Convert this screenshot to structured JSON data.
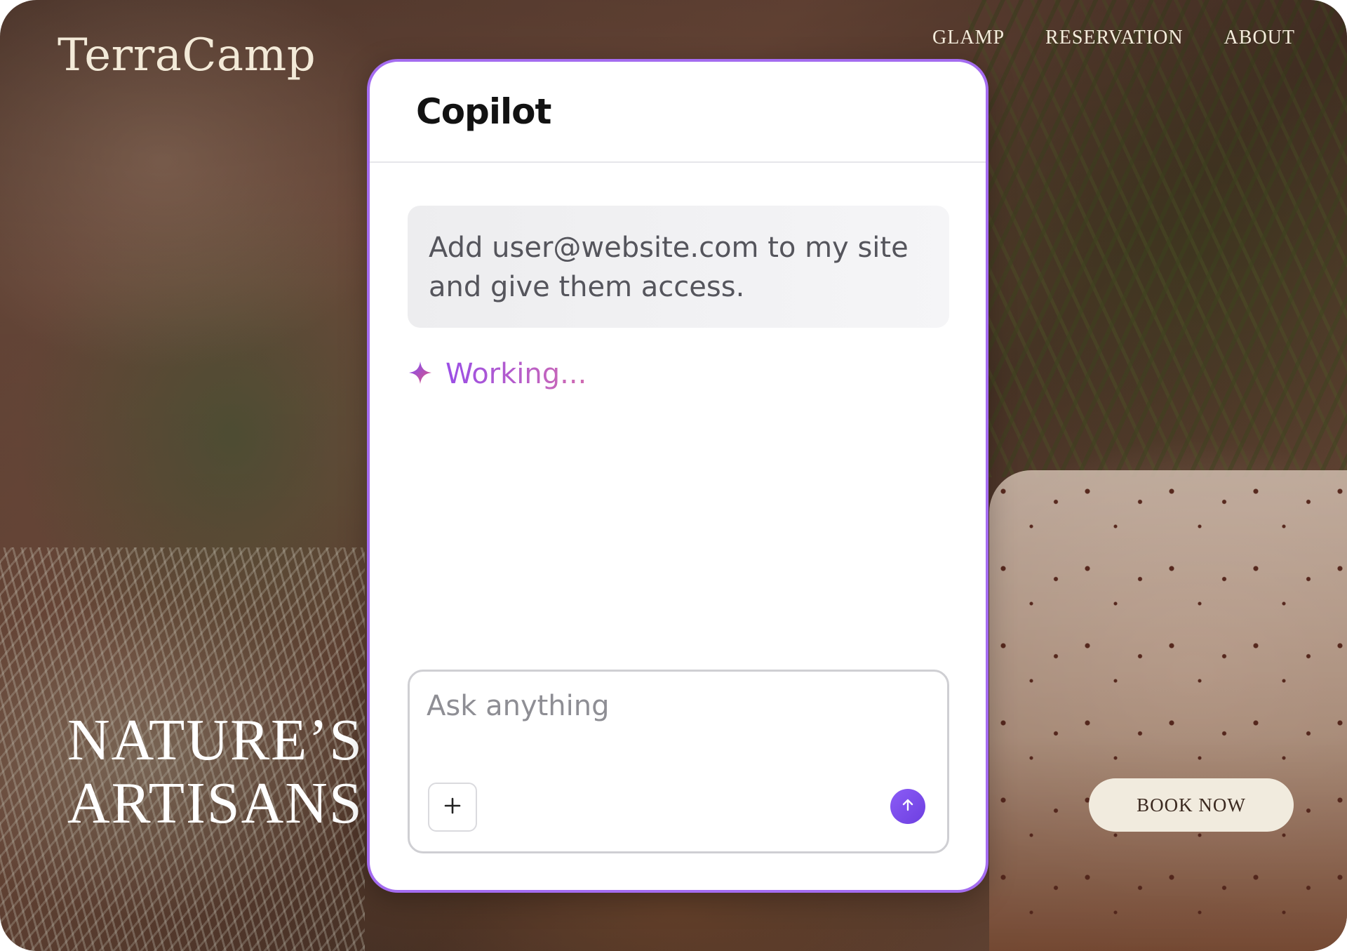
{
  "site": {
    "logo": "TerraCamp",
    "nav": [
      {
        "label": "GLAMP"
      },
      {
        "label": "RESERVATION"
      },
      {
        "label": "ABOUT"
      }
    ],
    "hero": {
      "line1": "NATURE’S",
      "line2": "ARTISANS"
    },
    "book_button": "BOOK NOW"
  },
  "copilot": {
    "title": "Copilot",
    "user_message": "Add user@website.com to my site and give them access.",
    "status": "Working...",
    "status_icon": "sparkle-icon",
    "composer": {
      "placeholder": "Ask anything",
      "add_icon": "plus-icon",
      "send_icon": "arrow-up-icon"
    },
    "accent_color": "#a46cf0"
  }
}
